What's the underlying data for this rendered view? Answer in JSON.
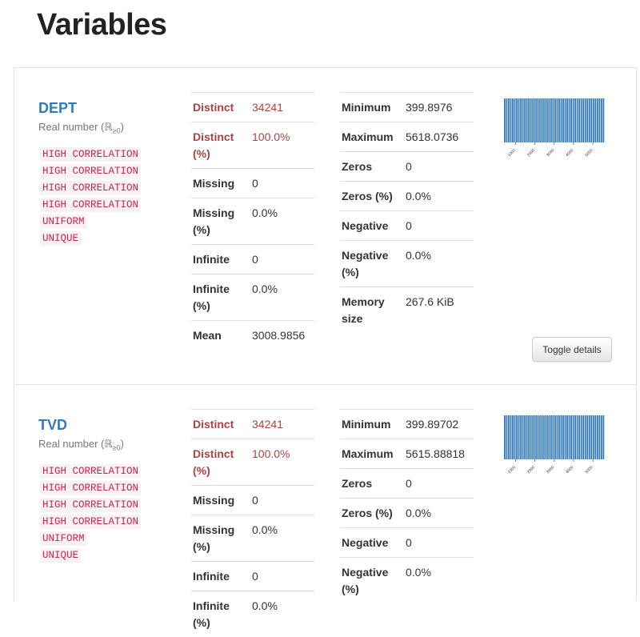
{
  "page": {
    "title": "Variables"
  },
  "variables": [
    {
      "name": "DEPT",
      "type_text": "Real number (ℝ",
      "type_sub": "≥0",
      "type_close": ")",
      "alerts": [
        "HIGH CORRELATION",
        "HIGH CORRELATION",
        "HIGH CORRELATION",
        "HIGH CORRELATION",
        "UNIFORM",
        "UNIQUE"
      ],
      "stats_left": [
        {
          "label": "Distinct",
          "value": "34241",
          "alert": true
        },
        {
          "label": "Distinct (%)",
          "value": "100.0%",
          "alert": true
        },
        {
          "label": "Missing",
          "value": "0",
          "alert": false
        },
        {
          "label": "Missing (%)",
          "value": "0.0%",
          "alert": false
        },
        {
          "label": "Infinite",
          "value": "0",
          "alert": false
        },
        {
          "label": "Infinite (%)",
          "value": "0.0%",
          "alert": false
        },
        {
          "label": "Mean",
          "value": "3008.9856",
          "alert": false
        }
      ],
      "stats_right": [
        {
          "label": "Minimum",
          "value": "399.8976"
        },
        {
          "label": "Maximum",
          "value": "5618.0736"
        },
        {
          "label": "Zeros",
          "value": "0"
        },
        {
          "label": "Zeros (%)",
          "value": "0.0%"
        },
        {
          "label": "Negative",
          "value": "0"
        },
        {
          "label": "Negative (%)",
          "value": "0.0%"
        },
        {
          "label": "Memory size",
          "value": "267.6 KiB"
        }
      ],
      "toggle_label": "Toggle details",
      "chart_data": {
        "type": "bar",
        "bar_color": "#337ab7",
        "tick_labels": [
          "1000",
          "2000",
          "3000",
          "4000",
          "5000"
        ],
        "ticks": [
          1000,
          2000,
          3000,
          4000,
          5000
        ],
        "xlim": [
          399.8976,
          5618.0736
        ],
        "bins": 50,
        "values": [
          1,
          1,
          1,
          1,
          1,
          1,
          1,
          1,
          1,
          1,
          1,
          1,
          1,
          1,
          1,
          1,
          1,
          1,
          1,
          1,
          1,
          1,
          1,
          1,
          1,
          1,
          1,
          1,
          1,
          1,
          1,
          1,
          1,
          1,
          1,
          1,
          1,
          1,
          1,
          1,
          1,
          1,
          1,
          1,
          1,
          1,
          1,
          1,
          1,
          1
        ]
      }
    },
    {
      "name": "TVD",
      "type_text": "Real number (ℝ",
      "type_sub": "≥0",
      "type_close": ")",
      "alerts": [
        "HIGH CORRELATION",
        "HIGH CORRELATION",
        "HIGH CORRELATION",
        "HIGH CORRELATION",
        "UNIFORM",
        "UNIQUE"
      ],
      "stats_left": [
        {
          "label": "Distinct",
          "value": "34241",
          "alert": true
        },
        {
          "label": "Distinct (%)",
          "value": "100.0%",
          "alert": true
        },
        {
          "label": "Missing",
          "value": "0",
          "alert": false
        },
        {
          "label": "Missing (%)",
          "value": "0.0%",
          "alert": false
        },
        {
          "label": "Infinite",
          "value": "0",
          "alert": false
        },
        {
          "label": "Infinite (%)",
          "value": "0.0%",
          "alert": false
        }
      ],
      "stats_right": [
        {
          "label": "Minimum",
          "value": "399.89702"
        },
        {
          "label": "Maximum",
          "value": "5615.88818"
        },
        {
          "label": "Zeros",
          "value": "0"
        },
        {
          "label": "Zeros (%)",
          "value": "0.0%"
        },
        {
          "label": "Negative",
          "value": "0"
        },
        {
          "label": "Negative (%)",
          "value": "0.0%"
        }
      ],
      "chart_data": {
        "type": "bar",
        "bar_color": "#337ab7",
        "tick_labels": [
          "1000",
          "2000",
          "3000",
          "4000",
          "5000"
        ],
        "ticks": [
          1000,
          2000,
          3000,
          4000,
          5000
        ],
        "xlim": [
          399.89702,
          5615.88818
        ],
        "bins": 50,
        "values": [
          1,
          1,
          1,
          1,
          1,
          1,
          1,
          1,
          1,
          1,
          1,
          1,
          1,
          1,
          1,
          1,
          1,
          1,
          1,
          1,
          1,
          1,
          1,
          1,
          1,
          1,
          1,
          1,
          1,
          1,
          1,
          1,
          1,
          1,
          1,
          1,
          1,
          1,
          1,
          1,
          1,
          1,
          1,
          1,
          1,
          1,
          1,
          1,
          1,
          1
        ]
      }
    }
  ]
}
